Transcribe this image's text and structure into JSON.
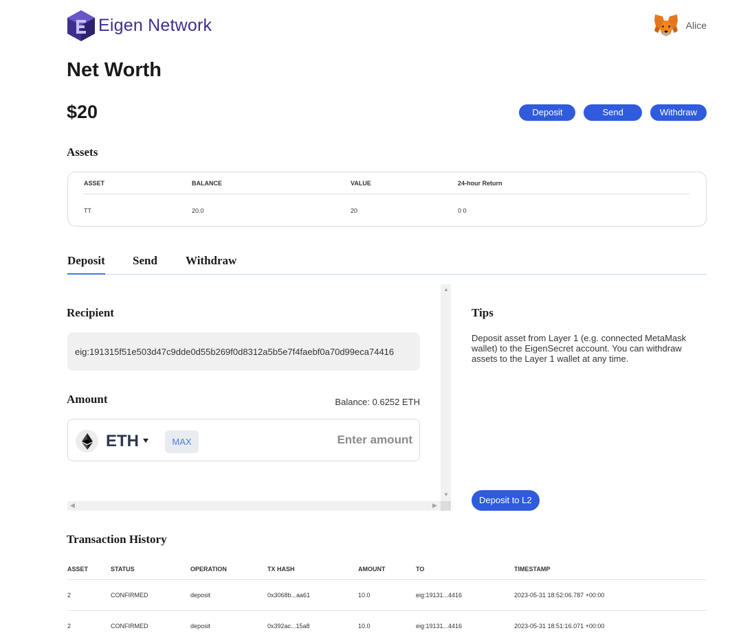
{
  "header": {
    "brand": "Eigen Network",
    "user_name": "Alice"
  },
  "page_title": "Net Worth",
  "net_worth": "$20",
  "actions": {
    "deposit": "Deposit",
    "send": "Send",
    "withdraw": "Withdraw"
  },
  "assets": {
    "title": "Assets",
    "columns": [
      "ASSET",
      "BALANCE",
      "VALUE",
      "24-hour Return"
    ],
    "rows": [
      [
        "TT",
        "20.0",
        "20",
        "0 0"
      ]
    ]
  },
  "tabs": [
    "Deposit",
    "Send",
    "Withdraw"
  ],
  "active_tab": "Deposit",
  "deposit_form": {
    "recipient_label": "Recipient",
    "recipient_value": "eig:191315f51e503d47c9dde0d55b269f0d8312a5b5e7f4faebf0a70d99eca74416",
    "amount_label": "Amount",
    "balance": "Balance: 0.6252 ETH",
    "token": "ETH",
    "max_label": "MAX",
    "amount_placeholder": "Enter amount"
  },
  "tips": {
    "title": "Tips",
    "text": "Deposit asset from Layer 1 (e.g. connected MetaMask wallet) to the EigenSecret account. You can withdraw assets to the Layer 1 wallet at any time.",
    "button": "Deposit to L2"
  },
  "history": {
    "title": "Transaction History",
    "columns": [
      "ASSET",
      "STATUS",
      "OPERATION",
      "TX HASH",
      "AMOUNT",
      "TO",
      "TIMESTAMP"
    ],
    "rows": [
      [
        "2",
        "CONFIRMED",
        "deposit",
        "0x3068b...aa61",
        "10.0",
        "eig:19131...4416",
        "2023-05-31 18:52:06.787 +00:00"
      ],
      [
        "2",
        "CONFIRMED",
        "deposit",
        "0x392ac...15a8",
        "10.0",
        "eig:19131...4416",
        "2023-05-31 18:51:16.071 +00:00"
      ]
    ]
  },
  "colors": {
    "primary": "#2f5bdc",
    "brand": "#3e2f8f",
    "tab_underline": "#3b7bd6"
  }
}
